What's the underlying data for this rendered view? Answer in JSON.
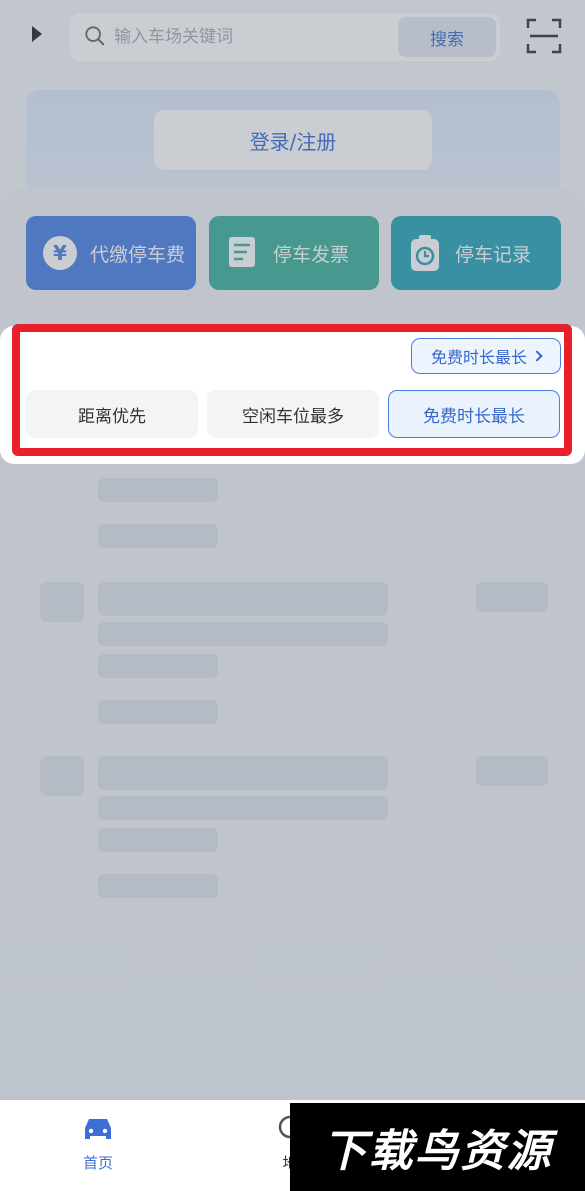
{
  "search": {
    "placeholder": "输入车场关键词",
    "button_label": "搜索"
  },
  "login": {
    "label": "登录/注册"
  },
  "quick_actions": [
    {
      "label": "代缴停车费",
      "icon": "yen-icon",
      "color": "#4a82e6"
    },
    {
      "label": "停车发票",
      "icon": "invoice-icon",
      "color": "#3eb39e"
    },
    {
      "label": "停车记录",
      "icon": "clock-icon",
      "color": "#2aa6b8"
    }
  ],
  "sort": {
    "current_label": "免费时长最长",
    "options": [
      {
        "label": "距离优先",
        "selected": false
      },
      {
        "label": "空闲车位最多",
        "selected": false
      },
      {
        "label": "免费时长最长",
        "selected": true
      }
    ]
  },
  "tabs": [
    {
      "label": "首页",
      "active": true,
      "icon": "car-icon"
    },
    {
      "label": "地",
      "active": false,
      "icon": "map-pin-icon"
    }
  ],
  "watermark": {
    "text": "下载鸟资源"
  },
  "colors": {
    "accent": "#3b6fd6",
    "highlight_frame": "#e8202a"
  }
}
